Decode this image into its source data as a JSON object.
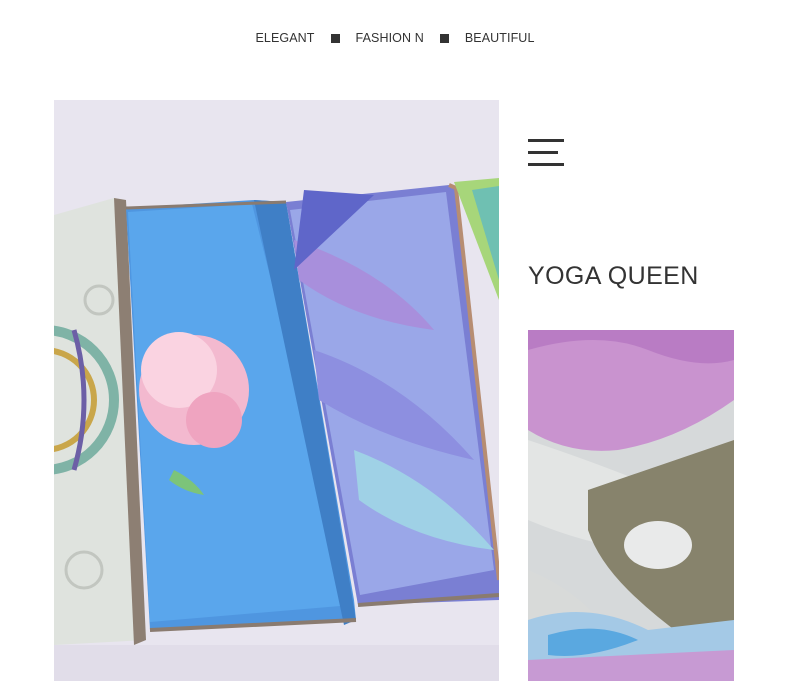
{
  "tagline": {
    "items": [
      "ELEGANT",
      "FASHION N",
      "BEAUTIFUL"
    ]
  },
  "title": "YOGA QUEEN",
  "icons": {
    "menu": "hamburger-menu-icon",
    "separator": "square-bullet-icon"
  },
  "images": {
    "main": "folded-yoga-mats-photo",
    "detail": "yoga-mat-closeup-photo"
  },
  "colors": {
    "text": "#333333",
    "background": "#ffffff"
  }
}
